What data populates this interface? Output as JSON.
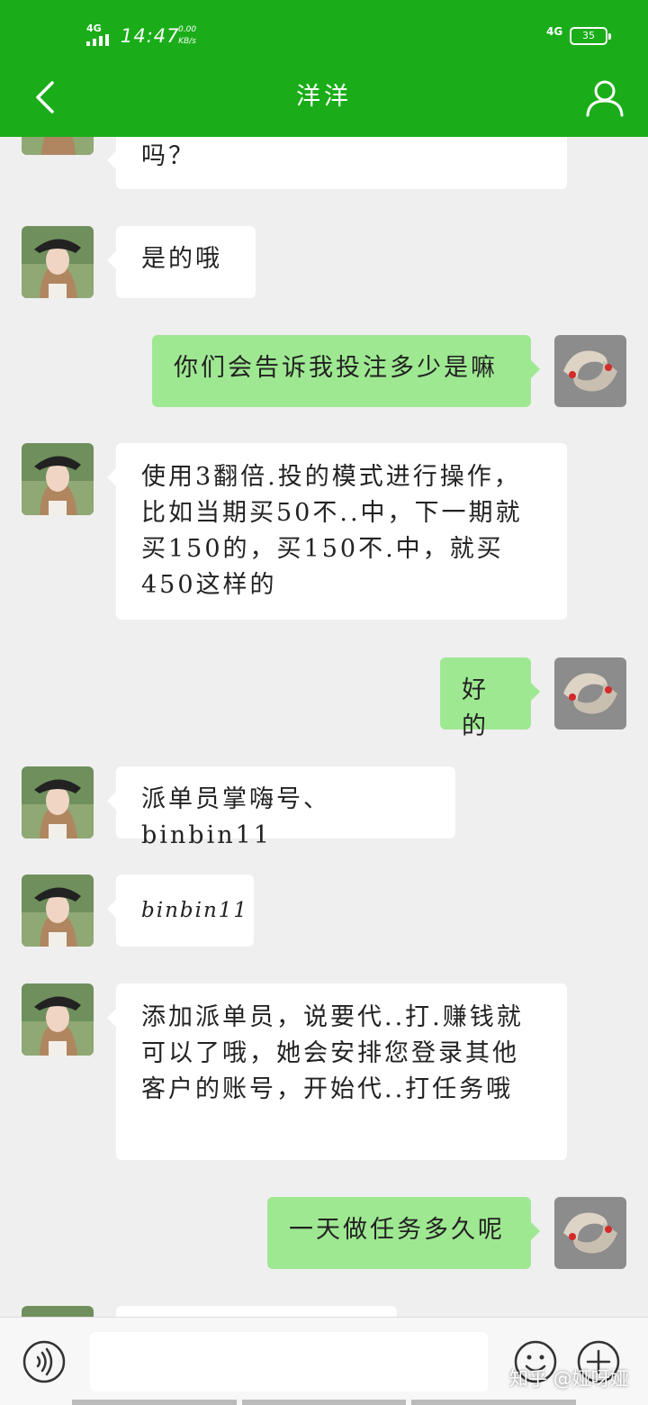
{
  "status_bar": {
    "network_left": "4G",
    "time": "14:47",
    "speed_value": "0.00",
    "speed_unit": "KB/s",
    "network_right": "4G",
    "battery": "35"
  },
  "header": {
    "title": "洋洋",
    "back_icon": "chevron-left-icon",
    "profile_icon": "user-icon"
  },
  "messages": [
    {
      "side": "in",
      "text": "吗？"
    },
    {
      "side": "in",
      "text": "是的哦"
    },
    {
      "side": "out",
      "text": "你们会告诉我投注多少是嘛"
    },
    {
      "side": "in",
      "text": "使用3翻倍.投的模式进行操作，比如当期买50不..中，下一期就买150的，买150不.中，就买450这样的"
    },
    {
      "side": "out",
      "text": "好的"
    },
    {
      "side": "in",
      "text": "派单员掌嗨号、binbin11"
    },
    {
      "side": "in",
      "text": "binbin11"
    },
    {
      "side": "in",
      "text": "添加派单员，说要代..打.赚钱就可以了哦，她会安排您登录其他客户的账号，开始代..打任务哦"
    },
    {
      "side": "out",
      "text": "一天做任务多久呢"
    }
  ],
  "input_bar": {
    "voice_icon": "voice-icon",
    "input_value": "",
    "emoji_icon": "emoji-icon",
    "plus_icon": "plus-icon"
  },
  "watermark": "知乎 @娅呀娅",
  "colors": {
    "header": "#1aad19",
    "outgoing_bubble": "#9fe892",
    "incoming_bubble": "#ffffff",
    "background": "#efefef"
  }
}
